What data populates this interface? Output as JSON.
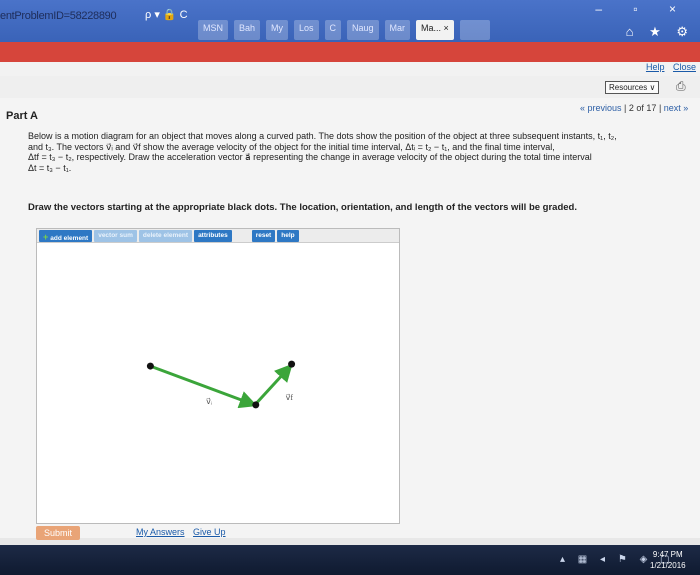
{
  "browser": {
    "url": "entProblemID=58228890",
    "url_tools": "ρ ▾ 🔒 C",
    "tabs": [
      {
        "label": "MSN",
        "active": false
      },
      {
        "label": "Bah",
        "active": false
      },
      {
        "label": "My",
        "active": false
      },
      {
        "label": "Los",
        "active": false
      },
      {
        "label": "C",
        "active": false
      },
      {
        "label": "Naug",
        "active": false
      },
      {
        "label": "Mar",
        "active": false
      },
      {
        "label": "Ma... ×",
        "active": true
      },
      {
        "label": "",
        "active": false
      }
    ],
    "window_controls": "– ▫ ×",
    "nav_icons": "⌂ ★ ⚙"
  },
  "site": {
    "help": "Help",
    "close": "Close",
    "resources": "Resources",
    "pager": {
      "previous": "« previous",
      "position": "2 of 17",
      "next": "next »"
    }
  },
  "problem": {
    "part": "Part A",
    "text_lines": [
      "Below is a motion diagram for an object that moves along a curved path. The dots show the position of the object at three subsequent instants, t₁, t₂,",
      "and t₃. The vectors v⃗ᵢ and v⃗f show the average velocity of the object for the initial time interval, Δtᵢ = t₂ − t₁, and the final time interval,",
      "Δtf = t₃ − t₂, respectively. Draw the acceleration vector a⃗ representing the change in average velocity of the object during the total time interval",
      "Δt = t₃ − t₁."
    ],
    "instruction": "Draw the vectors starting at the appropriate black dots. The location, orientation, and length of the vectors will be graded."
  },
  "tool": {
    "buttons": {
      "add_element": "add element",
      "vector_sum": "vector sum",
      "delete_element": "delete element",
      "attributes": "attributes",
      "reset": "reset",
      "help": "help"
    },
    "vector_labels": {
      "vi": "v⃗ᵢ",
      "vf": "v⃗f"
    },
    "colors": {
      "vector": "#3ba53a",
      "dot": "#111111"
    }
  },
  "footer": {
    "submit": "Submit",
    "my_answers": "My Answers",
    "give_up": "Give Up"
  },
  "taskbar": {
    "time": "9:47 PM",
    "date": "1/21/2016",
    "tray": "▴ ▦ ◂ ⚑ ◈ ▢"
  }
}
